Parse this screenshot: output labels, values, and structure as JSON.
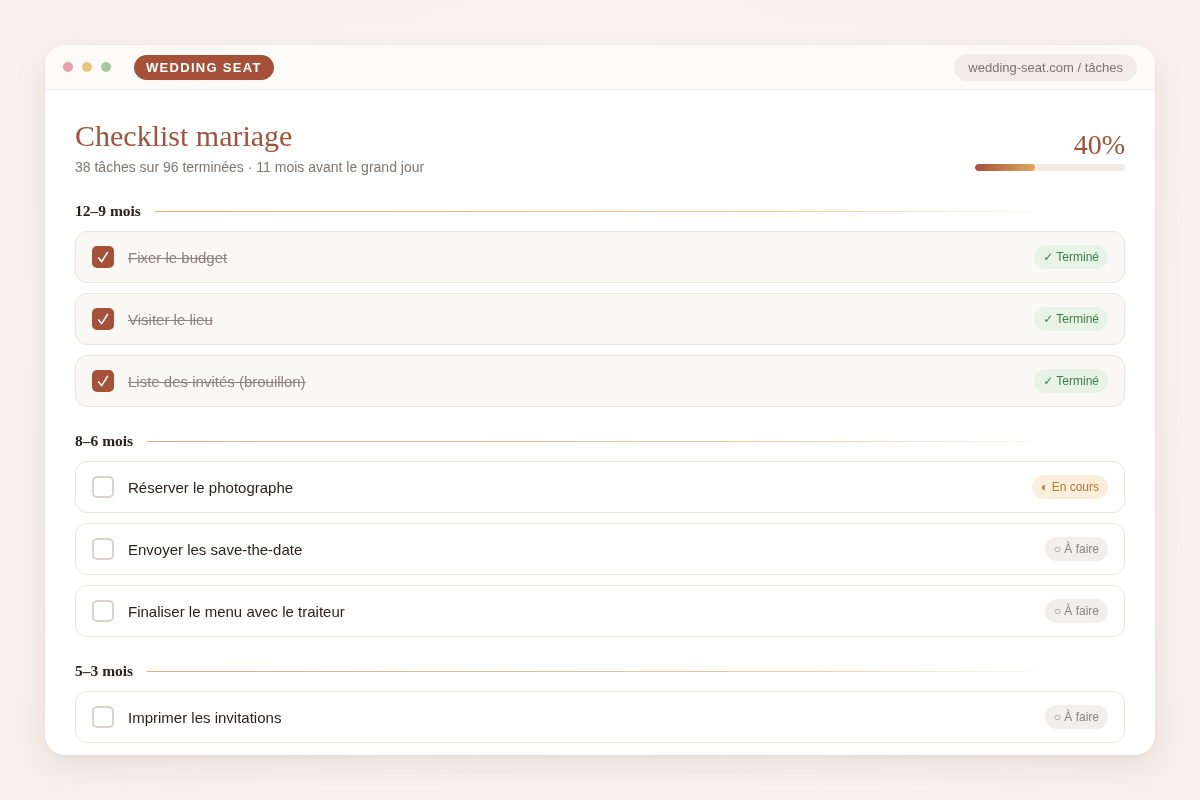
{
  "brand": "WEDDING SEAT",
  "address": "wedding-seat.com / tâches",
  "header": {
    "title": "Checklist mariage",
    "subtitle": "38 tâches sur 96 terminées · 11 mois avant le grand jour",
    "progress": {
      "reading": "40%",
      "level": 0.4
    }
  },
  "sections": [
    {
      "heading": "12–9 mois",
      "tasks": [
        {
          "label": "Fixer le budget",
          "checked": true,
          "status": {
            "kind": "done",
            "label": "✓ Terminé"
          }
        },
        {
          "label": "Visiter le lieu",
          "checked": true,
          "status": {
            "kind": "done",
            "label": "✓ Terminé"
          }
        },
        {
          "label": "Liste des invités (brouillon)",
          "checked": true,
          "status": {
            "kind": "done",
            "label": "✓ Terminé"
          }
        }
      ]
    },
    {
      "heading": "8–6 mois",
      "tasks": [
        {
          "label": "Réserver le photographe",
          "checked": false,
          "status": {
            "kind": "in_progress",
            "label": "◐ En cours"
          }
        },
        {
          "label": "Envoyer les save-the-date",
          "checked": false,
          "status": {
            "kind": "todo",
            "label": "○ À faire"
          }
        },
        {
          "label": "Finaliser le menu avec le traiteur",
          "checked": false,
          "status": {
            "kind": "todo",
            "label": "○ À faire"
          }
        }
      ]
    },
    {
      "heading": "5–3 mois",
      "tasks": [
        {
          "label": "Imprimer les invitations",
          "checked": false,
          "status": {
            "kind": "todo",
            "label": "○ À faire"
          }
        }
      ]
    }
  ]
}
